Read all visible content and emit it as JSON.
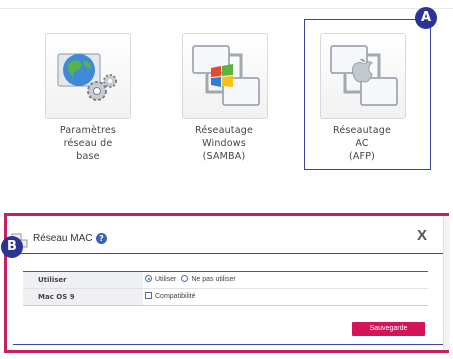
{
  "tiles": [
    {
      "id": "network-settings",
      "label_lines": [
        "Paramètres",
        "réseau de",
        "base"
      ],
      "icon": "globe-gear-icon"
    },
    {
      "id": "windows-networking",
      "label_lines": [
        "Réseautage",
        "Windows",
        "(SAMBA)"
      ],
      "icon": "windows-network-icon"
    },
    {
      "id": "mac-networking",
      "label_lines": [
        "Réseautage",
        "AC",
        "(AFP)"
      ],
      "icon": "apple-network-icon"
    }
  ],
  "callouts": {
    "a": "A",
    "b": "B"
  },
  "dialog": {
    "title": "Réseau MAC",
    "help": "?",
    "close": "X",
    "rows": [
      {
        "label": "Utiliser",
        "options": [
          {
            "text": "Utiliser",
            "selected": true
          },
          {
            "text": "Ne pas utiliser",
            "selected": false
          }
        ]
      },
      {
        "label": "Mac OS 9",
        "checkbox": {
          "text": "Compatibilité",
          "checked": false
        }
      }
    ],
    "save_label": "Sauvegarde"
  },
  "colors": {
    "accent": "#c61f62",
    "callout": "#2b3496",
    "button": "#d4145a"
  }
}
